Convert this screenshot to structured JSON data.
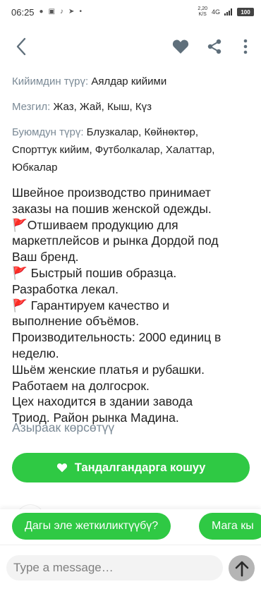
{
  "status_bar": {
    "time": "06:25",
    "net_speed_value": "2,20",
    "net_speed_unit": "K/S",
    "signal": "4G",
    "battery": "100"
  },
  "top_bar": {
    "back_icon": "chevron-left-icon",
    "favorite_icon": "heart-icon",
    "share_icon": "share-icon",
    "more_icon": "more-vertical-icon"
  },
  "attributes": {
    "clothing_type": {
      "label": "Кийимдин түрү:",
      "value": "Аялдар кийими"
    },
    "season": {
      "label": "Мезгил:",
      "value": "Жаз, Жай, Кыш, Күз"
    },
    "item_type": {
      "label": "Буюмдун түрү:",
      "value_lines": [
        "Блузкалар, Көйнөктөр,",
        "Спорттук кийим, Футболкалар, Халаттар,",
        "Юбкалар"
      ]
    }
  },
  "description": {
    "flag_icon": "red-flag-icon",
    "lines": [
      "Швейное производство принимает",
      "заказы на пошив женской одежды.",
      "Отшиваем продукцию для",
      "маркетплейсов и рынка Дордой под",
      "Ваш бренд.",
      " Быстрый пошив образца.",
      "Разработка лекал.",
      " Гарантируем качество и",
      "выполнение объёмов.",
      "Производительность: 2000 единиц в",
      "неделю.",
      "Шьём женские платья и рубашки.",
      "Работаем на долгосрок.",
      "Цех находится в здании завода",
      "Триод. Район рынка Мадина."
    ]
  },
  "show_more": "Азыраак көрсөтүү",
  "favorite_button": {
    "label": "Тандалгандарга кошуу",
    "icon": "heart-icon"
  },
  "suggestions": [
    "Дагы эле жеткиликтүүбү?",
    "Мага кы"
  ],
  "composer": {
    "placeholder": "Type a message…",
    "send_icon": "arrow-up-icon"
  },
  "colors": {
    "accent_green": "#2fc944",
    "muted_label": "#7b8a96",
    "icon_gray": "#5f6f7b",
    "flag_red": "#e53935"
  }
}
